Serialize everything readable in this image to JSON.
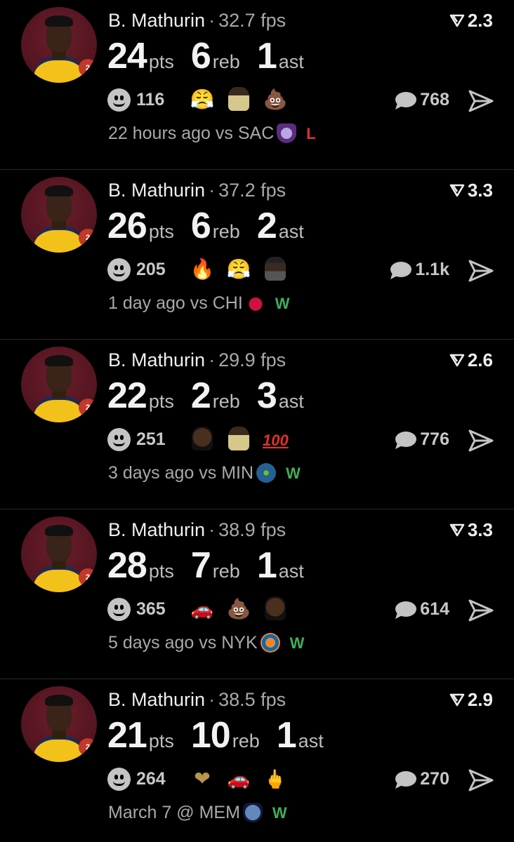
{
  "colors": {
    "background": "#000000",
    "loss": "#e0323a",
    "win": "#3fae5a",
    "muted": "#a9a9a9"
  },
  "posts": [
    {
      "player": "B. Mathurin",
      "fps": "32.7 fps",
      "score": "2.3",
      "stats": [
        {
          "value": "24",
          "unit": "pts"
        },
        {
          "value": "6",
          "unit": "reb"
        },
        {
          "value": "1",
          "unit": "ast"
        }
      ],
      "reaction_count": "116",
      "emojis": [
        "face-with-steam-emoji",
        "player-photo-emoji",
        "poop-emoji"
      ],
      "comment_count": "768",
      "time": "22 hours ago",
      "opponent": "vs SAC",
      "opponent_logo": "kings-logo-icon",
      "result": "L"
    },
    {
      "player": "B. Mathurin",
      "fps": "37.2 fps",
      "score": "3.3",
      "stats": [
        {
          "value": "26",
          "unit": "pts"
        },
        {
          "value": "6",
          "unit": "reb"
        },
        {
          "value": "2",
          "unit": "ast"
        }
      ],
      "reaction_count": "205",
      "emojis": [
        "fire-emoji",
        "face-with-steam-emoji",
        "cowboy-person-emoji"
      ],
      "comment_count": "1.1k",
      "time": "1 day ago",
      "opponent": "vs CHI",
      "opponent_logo": "bulls-logo-icon",
      "result": "W"
    },
    {
      "player": "B. Mathurin",
      "fps": "29.9 fps",
      "score": "2.6",
      "stats": [
        {
          "value": "22",
          "unit": "pts"
        },
        {
          "value": "2",
          "unit": "reb"
        },
        {
          "value": "3",
          "unit": "ast"
        }
      ],
      "reaction_count": "251",
      "emojis": [
        "player-face-emoji",
        "player-photo-emoji",
        "hundred-emoji"
      ],
      "hundred_text": "100",
      "comment_count": "776",
      "time": "3 days ago",
      "opponent": "vs MIN",
      "opponent_logo": "timberwolves-logo-icon",
      "result": "W"
    },
    {
      "player": "B. Mathurin",
      "fps": "38.9 fps",
      "score": "3.3",
      "stats": [
        {
          "value": "28",
          "unit": "pts"
        },
        {
          "value": "7",
          "unit": "reb"
        },
        {
          "value": "1",
          "unit": "ast"
        }
      ],
      "reaction_count": "365",
      "emojis": [
        "race-car-emoji",
        "poop-emoji",
        "player-face-emoji"
      ],
      "comment_count": "614",
      "time": "5 days ago",
      "opponent": "vs NYK",
      "opponent_logo": "knicks-logo-icon",
      "result": "W"
    },
    {
      "player": "B. Mathurin",
      "fps": "38.5 fps",
      "score": "2.9",
      "stats": [
        {
          "value": "21",
          "unit": "pts"
        },
        {
          "value": "10",
          "unit": "reb"
        },
        {
          "value": "1",
          "unit": "ast"
        }
      ],
      "reaction_count": "264",
      "emojis": [
        "gold-heart-emoji",
        "race-car-emoji",
        "middle-finger-emoji"
      ],
      "comment_count": "270",
      "time": "March 7",
      "opponent": "@ MEM",
      "opponent_logo": "grizzlies-logo-icon",
      "result": "W"
    }
  ]
}
